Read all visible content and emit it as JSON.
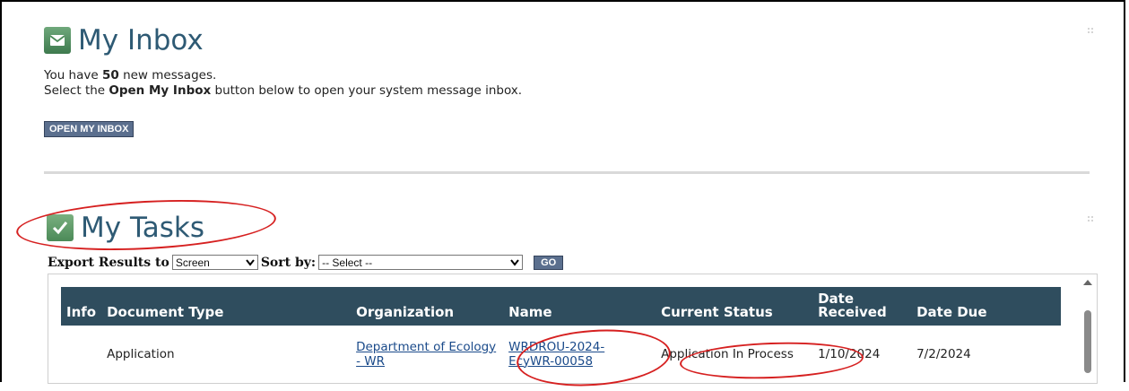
{
  "inbox": {
    "title": "My Inbox",
    "message_prefix": "You have ",
    "message_count": "50",
    "message_suffix": " new messages.",
    "instruction_prefix": "Select the ",
    "instruction_bold": "Open My Inbox",
    "instruction_suffix": " button below to open your system message inbox.",
    "open_button": "OPEN MY INBOX"
  },
  "tasks": {
    "title": "My Tasks",
    "export_label": "Export Results to",
    "export_value": "Screen",
    "sort_label": "Sort by:",
    "sort_value": "-- Select --",
    "go_button": "GO",
    "columns": [
      "Info",
      "Document Type",
      "Organization",
      "Name",
      "Current Status",
      "Date Received",
      "Date Due"
    ],
    "rows": [
      {
        "info": "",
        "document_type": "Application",
        "organization": "Department of Ecology - WR",
        "name": "WRDROU-2024-EcyWR-00058",
        "current_status": "Application In Process",
        "date_received": "1/10/2024",
        "date_due": "7/2/2024"
      }
    ]
  },
  "icons": {
    "inbox": "envelope-icon",
    "tasks": "checkmark-icon",
    "drag": "drag-handle-icon",
    "dropdown": "chevron-down-icon"
  },
  "colors": {
    "title": "#2e5a74",
    "header_bg": "#2f4d5e",
    "button_bg": "#5b6f8e",
    "annotation": "#d62020"
  }
}
